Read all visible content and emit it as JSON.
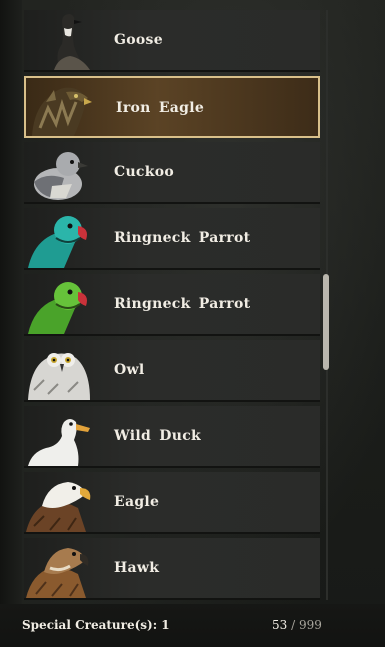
{
  "creatures": [
    {
      "name": "Goose",
      "icon": "goose-icon",
      "selected": false
    },
    {
      "name": "Iron Eagle",
      "icon": "iron-eagle-icon",
      "selected": true
    },
    {
      "name": "Cuckoo",
      "icon": "cuckoo-icon",
      "selected": false
    },
    {
      "name": "Ringneck Parrot",
      "icon": "ringneck-parrot-teal-icon",
      "selected": false
    },
    {
      "name": "Ringneck Parrot",
      "icon": "ringneck-parrot-green-icon",
      "selected": false
    },
    {
      "name": "Owl",
      "icon": "owl-icon",
      "selected": false
    },
    {
      "name": "Wild Duck",
      "icon": "wild-duck-icon",
      "selected": false
    },
    {
      "name": "Eagle",
      "icon": "eagle-icon",
      "selected": false
    },
    {
      "name": "Hawk",
      "icon": "hawk-icon",
      "selected": false
    }
  ],
  "footer": {
    "special_label": "Special Creature(s): 1",
    "count": "53",
    "separator": " / ",
    "max": "999"
  },
  "colors": {
    "selected_border": "#d9c08a",
    "row_bg": "#2a2b29"
  }
}
